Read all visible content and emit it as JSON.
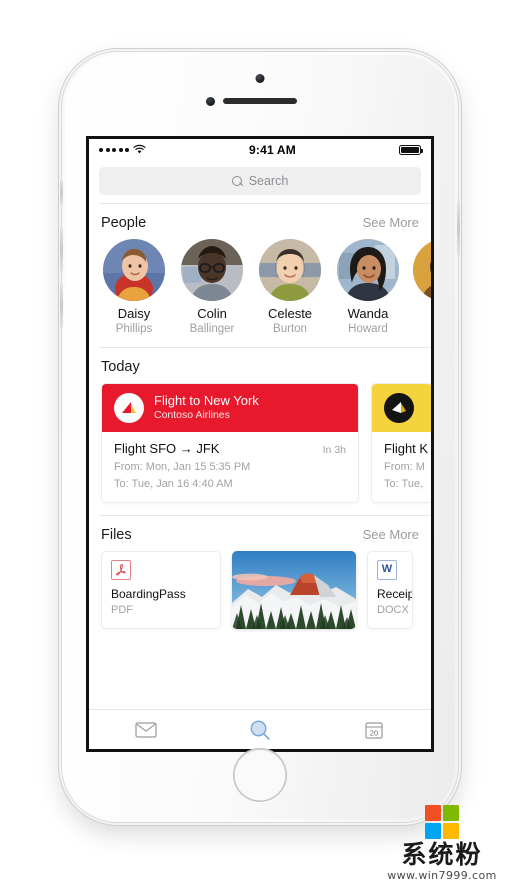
{
  "device": {
    "frame": "white-iphone",
    "home_button": "home-button"
  },
  "status_bar": {
    "signal_dots": 5,
    "wifi": "wifi-icon",
    "time": "9:41 AM",
    "battery": "battery-full-icon"
  },
  "search": {
    "placeholder": "Search",
    "value": "",
    "icon": "search-icon"
  },
  "people": {
    "title": "People",
    "see_more": "See More",
    "items": [
      {
        "first": "Daisy",
        "last": "Phillips"
      },
      {
        "first": "Colin",
        "last": "Ballinger"
      },
      {
        "first": "Celeste",
        "last": "Burton"
      },
      {
        "first": "Wanda",
        "last": "Howard"
      },
      {
        "first": "",
        "last": ""
      }
    ]
  },
  "today": {
    "title": "Today",
    "cards": [
      {
        "header_title": "Flight to New York",
        "header_sub": "Contoso Airlines",
        "header_color": "#e8192c",
        "logo": "contoso-airlines-logo",
        "route": "Flight SFO → JFK",
        "when": "In 3h",
        "from": "From: Mon, Jan 15 5:35 PM",
        "to": "To: Tue, Jan 16 4:40 AM"
      },
      {
        "header_title": "",
        "header_sub": "",
        "header_color": "#f5d33c",
        "logo": "fabrikam-airlines-logo",
        "route": "Flight K",
        "when": "",
        "from": "From: M",
        "to": "To: Tue,"
      }
    ]
  },
  "files": {
    "title": "Files",
    "see_more": "See More",
    "items": [
      {
        "name": "BoardingPass",
        "type": "PDF",
        "icon": "pdf-icon"
      },
      {
        "name": "",
        "type": "",
        "icon": "photo-thumbnail"
      },
      {
        "name": "Receipt",
        "type": "DOCX",
        "icon": "word-icon"
      }
    ]
  },
  "tabbar": {
    "tabs": [
      {
        "name": "mail",
        "icon": "mail-icon",
        "active": false
      },
      {
        "name": "search",
        "icon": "search-icon",
        "active": true
      },
      {
        "name": "calendar",
        "icon": "calendar-icon",
        "active": true,
        "day": "20"
      }
    ],
    "active_color": "#8fb8e0"
  },
  "watermark": {
    "title": "系统粉",
    "url": "www.win7999.com",
    "logo_colors": [
      "#f25022",
      "#7fba00",
      "#00a4ef",
      "#ffb900"
    ]
  }
}
